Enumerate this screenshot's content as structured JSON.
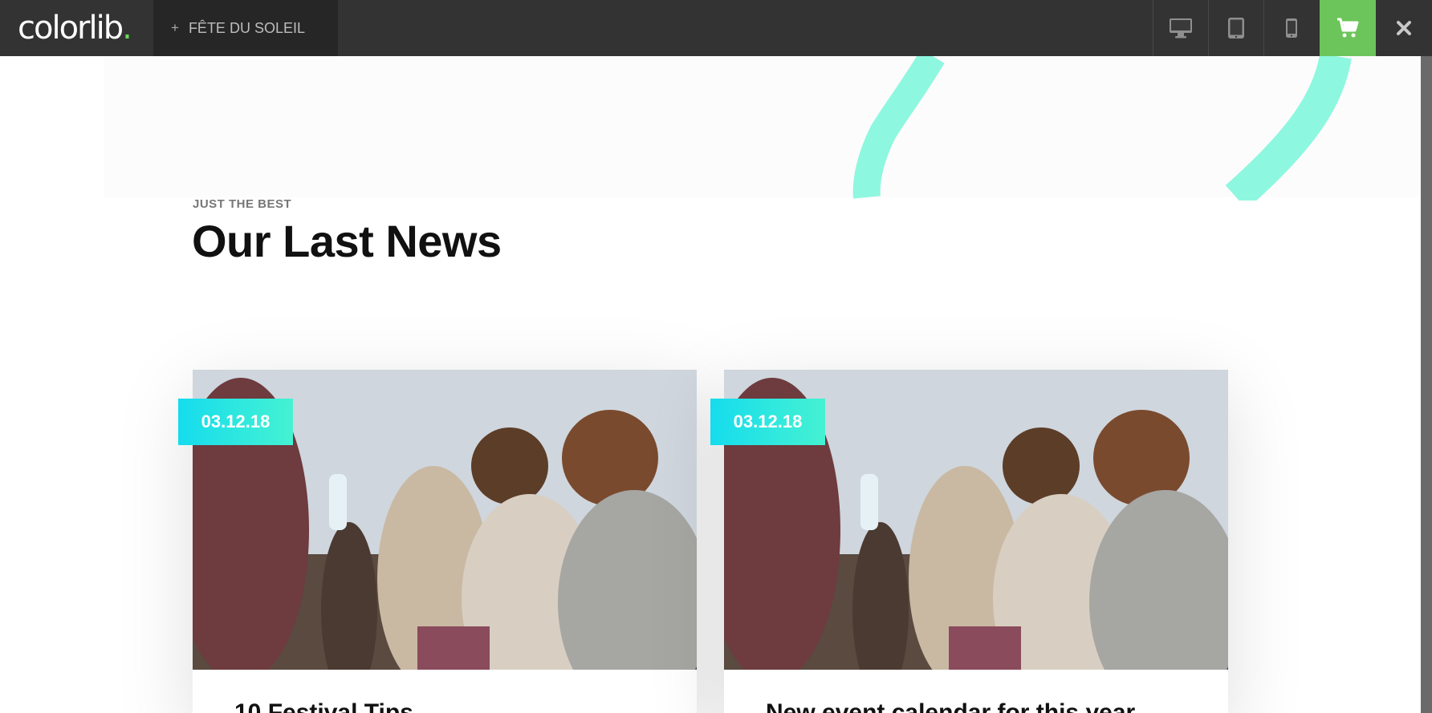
{
  "toolbar": {
    "logo_text": "colorlib",
    "logo_dot": ".",
    "theme_plus": "+",
    "theme_name": "FÊTE DU SOLEIL",
    "device_icons": [
      "desktop-icon",
      "tablet-icon",
      "mobile-icon"
    ],
    "cart_icon": "cart-icon",
    "close_icon": "close-icon"
  },
  "colors": {
    "toolbar_bg": "#333333",
    "buy_button": "#6cc55a",
    "badge_gradient": [
      "#15dced",
      "#45f2d2"
    ],
    "accent_stroke": "#8ef7df"
  },
  "section": {
    "eyebrow": "JUST THE BEST",
    "title": "Our Last News"
  },
  "posts": [
    {
      "date": "03.12.18",
      "title": "10 Festival Tips"
    },
    {
      "date": "03.12.18",
      "title": "New event calendar for this year"
    }
  ]
}
